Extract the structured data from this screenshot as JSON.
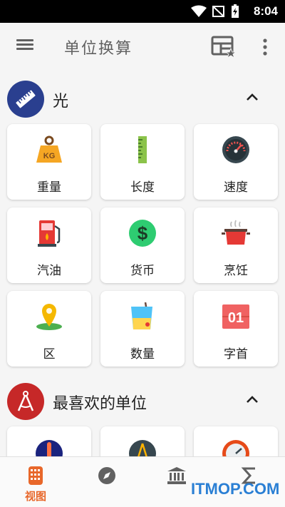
{
  "statusbar": {
    "time": "8:04"
  },
  "appbar": {
    "title": "单位换算"
  },
  "sections": [
    {
      "label": "光",
      "color": "#2a3f8f"
    },
    {
      "label": "最喜欢的单位",
      "color": "#c62828"
    }
  ],
  "cards": [
    {
      "label": "重量",
      "icon": "weight-kg-icon"
    },
    {
      "label": "长度",
      "icon": "ruler-icon"
    },
    {
      "label": "速度",
      "icon": "speedometer-icon"
    },
    {
      "label": "汽油",
      "icon": "fuel-pump-icon"
    },
    {
      "label": "货币",
      "icon": "dollar-coin-icon"
    },
    {
      "label": "烹饪",
      "icon": "cooking-pot-icon"
    },
    {
      "label": "区",
      "icon": "map-pin-icon"
    },
    {
      "label": "数量",
      "icon": "beaker-icon"
    },
    {
      "label": "字首",
      "icon": "prefix-01-icon"
    }
  ],
  "bottomnav": {
    "active_label": "视图",
    "accent": "#e8672a"
  },
  "watermark": "ITMOP.COM"
}
